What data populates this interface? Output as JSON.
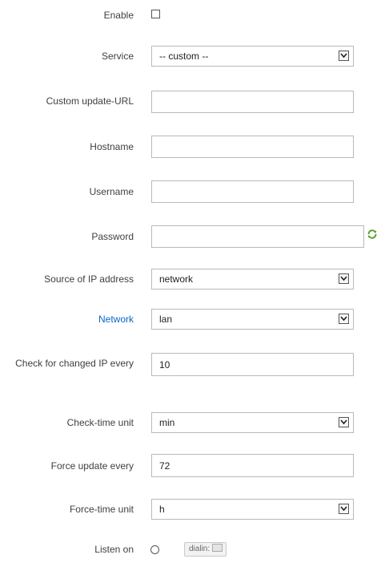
{
  "form": {
    "enable": {
      "label": "Enable",
      "checked": false
    },
    "service": {
      "label": "Service",
      "value": "-- custom --"
    },
    "custom_update_url": {
      "label": "Custom update-URL",
      "value": ""
    },
    "hostname": {
      "label": "Hostname",
      "value": ""
    },
    "username": {
      "label": "Username",
      "value": ""
    },
    "password": {
      "label": "Password",
      "value": ""
    },
    "ip_source": {
      "label": "Source of IP address",
      "value": "network"
    },
    "network": {
      "label": "Network",
      "value": "lan"
    },
    "check_interval": {
      "label": "Check for changed IP every",
      "value": "10"
    },
    "check_unit": {
      "label": "Check-time unit",
      "value": "min"
    },
    "force_interval": {
      "label": "Force update every",
      "value": "72"
    },
    "force_unit": {
      "label": "Force-time unit",
      "value": "h"
    },
    "listen_on": {
      "label": "Listen on",
      "interface": "dialin:",
      "selected": false
    }
  },
  "icons": {
    "password_reveal": "refresh-icon",
    "network_interface": "network-interface-icon"
  },
  "colors": {
    "link_label": "#0a67c9",
    "reveal_icon": "#5aa02c"
  }
}
